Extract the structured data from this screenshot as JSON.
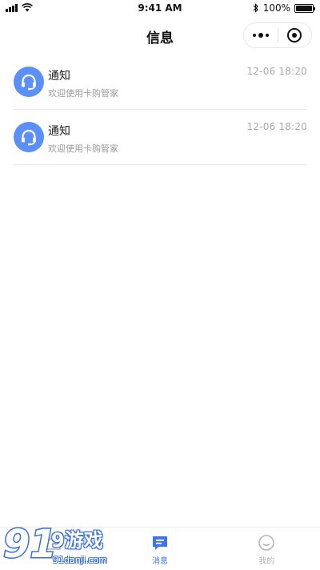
{
  "status_bar": {
    "time": "9:41 AM",
    "battery": "100%",
    "battery_level": 1.0
  },
  "nav": {
    "title": "信息"
  },
  "messages": [
    {
      "title": "通知",
      "subtitle": "欢迎使用卡购管家",
      "time": "12-06 18:20",
      "icon": "headset-icon"
    },
    {
      "title": "通知",
      "subtitle": "欢迎使用卡购管家",
      "time": "12-06 18:20",
      "icon": "headset-icon"
    }
  ],
  "tabs": [
    {
      "label": "",
      "icon": "home-icon",
      "active": false
    },
    {
      "label": "消息",
      "icon": "message-icon",
      "active": true
    },
    {
      "label": "我的",
      "icon": "profile-icon",
      "active": false
    }
  ],
  "watermark": {
    "text": "9游戏",
    "sub": "91danji.com"
  },
  "colors": {
    "accent": "#3f73f5",
    "avatar": "#5b8ff9",
    "inactive": "#b5b5b5"
  }
}
